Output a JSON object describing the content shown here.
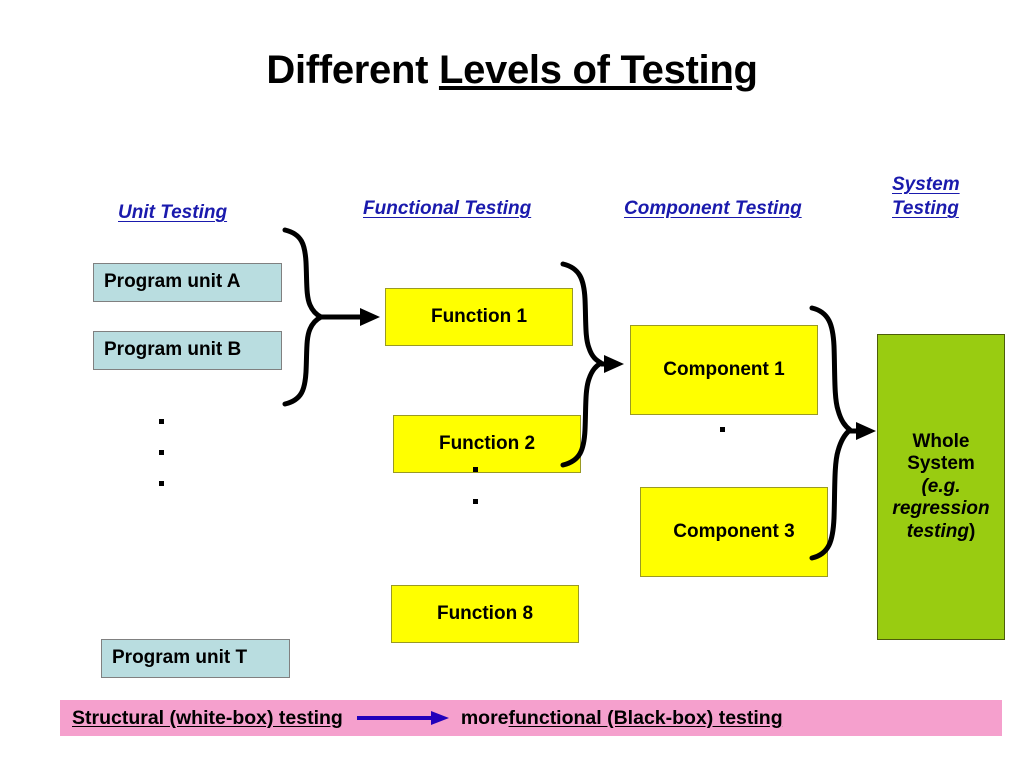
{
  "title": {
    "plain": "Different ",
    "underlined": "Levels of Testing"
  },
  "headings": {
    "unit": "Unit Testing",
    "functional": "Functional Testing",
    "component": "Component Testing",
    "system_line1": "System",
    "system_line2": "Testing"
  },
  "units": {
    "a": "Program unit A",
    "b": "Program unit B",
    "t": "Program unit T"
  },
  "functions": {
    "f1": "Function  1",
    "f2": "Function  2",
    "f8": "Function  8"
  },
  "components": {
    "c1": "Component  1",
    "c3": "Component  3"
  },
  "system": {
    "line1": "Whole",
    "line2": "System",
    "line3": "(e.g.",
    "line4": "regression",
    "line5": "testing",
    "line6": ")"
  },
  "banner": {
    "left_text": "Structural (white-box) testing",
    "mid_text": "more ",
    "right_text": "functional (Black-box) testing ",
    "arrow_icon": "right-arrow-icon"
  },
  "colors": {
    "heading_blue": "#1a1aad",
    "unit_box_fill": "#b9dde0",
    "function_box_fill": "#ffff00",
    "component_box_fill": "#ffff00",
    "system_box_fill": "#99cc11",
    "banner_fill": "#f5a0cd",
    "banner_arrow": "#2200bb",
    "ink": "#000000"
  },
  "ellipses": {
    "unit_column": "three vertical dots",
    "function_column": "two vertical dots",
    "component_column": "one dot"
  }
}
